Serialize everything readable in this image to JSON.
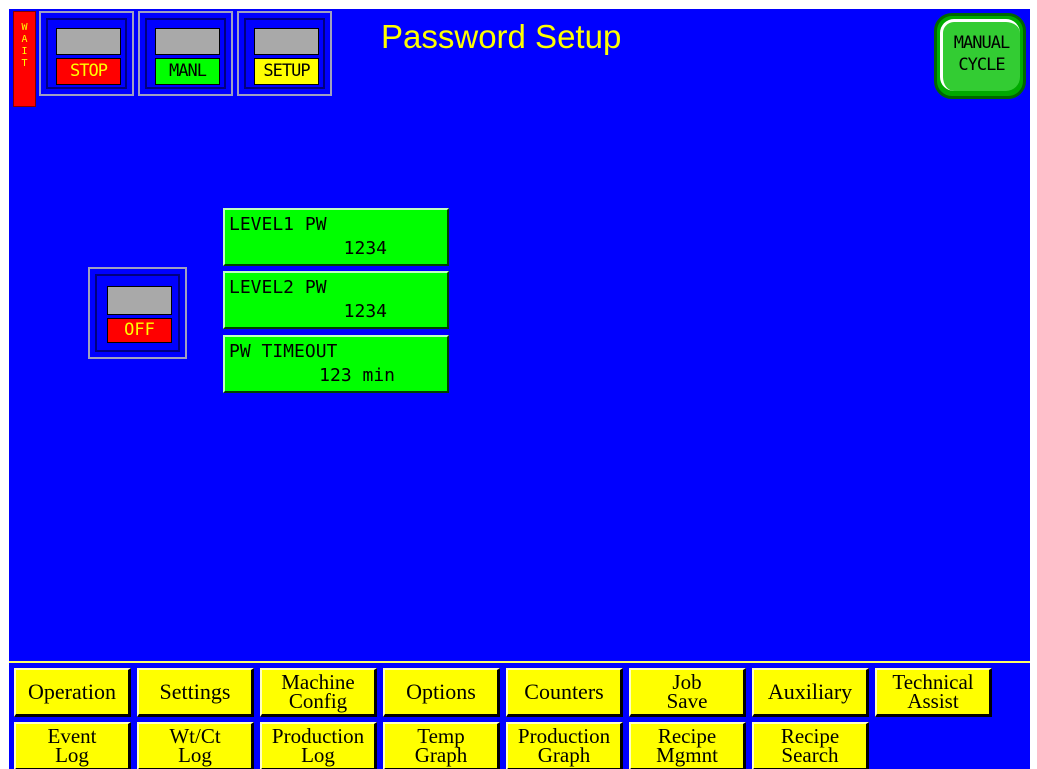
{
  "header": {
    "wait_label": "W\nA\nI\nT",
    "title": "Password Setup",
    "status_tiles": [
      {
        "label": "STOP",
        "color": "#ff0000",
        "text_color": "#ffff00"
      },
      {
        "label": "MANL",
        "color": "#00ff00",
        "text_color": "#000000"
      },
      {
        "label": "SETUP",
        "color": "#ffff00",
        "text_color": "#000000"
      }
    ],
    "manual_cycle": "MANUAL\nCYCLE"
  },
  "passwords": {
    "level1": {
      "label": "LEVEL1 PW",
      "value": "1234"
    },
    "level2": {
      "label": "LEVEL2 PW",
      "value": "1234"
    },
    "timeout": {
      "label": "PW TIMEOUT",
      "value": "123 min"
    }
  },
  "toggle": {
    "label": "OFF"
  },
  "nav": {
    "row1": [
      "Operation",
      "Settings",
      "Machine\nConfig",
      "Options",
      "Counters",
      "Job\nSave",
      "Auxiliary",
      "Technical\nAssist"
    ],
    "row2": [
      "Event\nLog",
      "Wt/Ct\nLog",
      "Production\nLog",
      "Temp\nGraph",
      "Production\nGraph",
      "Recipe\nMgmnt",
      "Recipe\nSearch"
    ]
  },
  "colors": {
    "background": "#0000ff",
    "button_yellow": "#ffff00",
    "field_green": "#00ff00",
    "alarm_red": "#ff0000"
  }
}
